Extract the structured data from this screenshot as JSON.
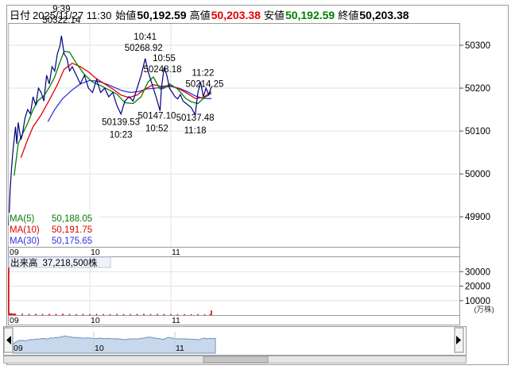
{
  "header": {
    "date_label": "日付",
    "datetime": "2025/11/27 11:30",
    "open_label": "始値",
    "open_value": "50,192.59",
    "high_label": "高値",
    "high_value": "50,203.38",
    "low_label": "安値",
    "low_value": "50,192.59",
    "close_label": "終値",
    "close_value": "50,203.38"
  },
  "legend": {
    "ma5_label": "MA(5)",
    "ma5_value": "50,188.05",
    "ma10_label": "MA(10)",
    "ma10_value": "50,191.75",
    "ma30_label": "MA(30)",
    "ma30_value": "50,175.65"
  },
  "volume_panel": {
    "label": "出来高",
    "value": "37,218,500株",
    "unit": "(万株)"
  },
  "annotations": [
    {
      "time": "9:39",
      "value": "50322.14"
    },
    {
      "time": "10:41",
      "value": "50268.92"
    },
    {
      "time": "10:55",
      "value": "50248.18"
    },
    {
      "time": "11:22",
      "value": "50214.25"
    },
    {
      "time": "10:23",
      "value": "50139.53"
    },
    {
      "time": "10:52",
      "value": "50147.10"
    },
    {
      "time": "11:18",
      "value": "50137.48"
    }
  ],
  "colors": {
    "up": "#e00000",
    "down": "#000080",
    "ma5": "#008000",
    "ma10": "#e00000",
    "ma30": "#3030e0",
    "high_value": "#e00000",
    "low_value": "#008000",
    "navigator_fill": "#c8d8ec",
    "navigator_line": "#6f8fb8"
  },
  "chart_data": {
    "type": "line",
    "title": "",
    "xlabel": "",
    "ylabel": "",
    "price_ylim": [
      49830,
      50350
    ],
    "price_ticks": [
      49900,
      50000,
      50100,
      50200,
      50300
    ],
    "volume_ticks": [
      10000,
      20000,
      30000
    ],
    "volume_unit": "(万株)",
    "x_ticks": [
      "09",
      "10",
      "11"
    ],
    "session": {
      "start": "09:00",
      "end": "11:30"
    },
    "grid": true,
    "legend": "bottom-left",
    "price": {
      "name": "price",
      "points": [
        [
          "09:00",
          49880
        ],
        [
          "09:01",
          49960
        ],
        [
          "09:02",
          50010
        ],
        [
          "09:03",
          50050
        ],
        [
          "09:04",
          50080
        ],
        [
          "09:05",
          50110
        ],
        [
          "09:06",
          50070
        ],
        [
          "09:07",
          50120
        ],
        [
          "09:08",
          50100
        ],
        [
          "09:09",
          50080
        ],
        [
          "09:10",
          50090
        ],
        [
          "09:12",
          50130
        ],
        [
          "09:14",
          50150
        ],
        [
          "09:16",
          50140
        ],
        [
          "09:18",
          50180
        ],
        [
          "09:20",
          50160
        ],
        [
          "09:22",
          50200
        ],
        [
          "09:24",
          50190
        ],
        [
          "09:26",
          50170
        ],
        [
          "09:28",
          50230
        ],
        [
          "09:30",
          50210
        ],
        [
          "09:32",
          50250
        ],
        [
          "09:34",
          50240
        ],
        [
          "09:36",
          50280
        ],
        [
          "09:38",
          50300
        ],
        [
          "09:39",
          50322.14
        ],
        [
          "09:41",
          50280
        ],
        [
          "09:43",
          50270
        ],
        [
          "09:45",
          50240
        ],
        [
          "09:47",
          50250
        ],
        [
          "09:50",
          50230
        ],
        [
          "09:53",
          50210
        ],
        [
          "09:56",
          50230
        ],
        [
          "09:59",
          50200
        ],
        [
          "10:02",
          50190
        ],
        [
          "10:05",
          50220
        ],
        [
          "10:08",
          50190
        ],
        [
          "10:11",
          50200
        ],
        [
          "10:14",
          50180
        ],
        [
          "10:17",
          50190
        ],
        [
          "10:20",
          50160
        ],
        [
          "10:23",
          50139.53
        ],
        [
          "10:26",
          50170
        ],
        [
          "10:29",
          50180
        ],
        [
          "10:32",
          50170
        ],
        [
          "10:35",
          50200
        ],
        [
          "10:38",
          50230
        ],
        [
          "10:41",
          50268.92
        ],
        [
          "10:43",
          50240
        ],
        [
          "10:45",
          50220
        ],
        [
          "10:47",
          50200
        ],
        [
          "10:49",
          50180
        ],
        [
          "10:52",
          50147.1
        ],
        [
          "10:53",
          50200
        ],
        [
          "10:55",
          50248.18
        ],
        [
          "10:57",
          50230
        ],
        [
          "10:59",
          50200
        ],
        [
          "11:01",
          50190
        ],
        [
          "11:03",
          50180
        ],
        [
          "11:05",
          50175
        ],
        [
          "11:07",
          50185
        ],
        [
          "11:09",
          50170
        ],
        [
          "11:11",
          50165
        ],
        [
          "11:13",
          50160
        ],
        [
          "11:15",
          50155
        ],
        [
          "11:18",
          50137.48
        ],
        [
          "11:20",
          50190
        ],
        [
          "11:22",
          50214.25
        ],
        [
          "11:24",
          50180
        ],
        [
          "11:26",
          50200
        ],
        [
          "11:28",
          50185
        ],
        [
          "11:30",
          50203.38
        ]
      ]
    },
    "series": [
      {
        "name": "MA(5)",
        "points": [
          [
            "09:04",
            49996
          ],
          [
            "09:07",
            50070
          ],
          [
            "09:10",
            50092
          ],
          [
            "09:14",
            50118
          ],
          [
            "09:18",
            50150
          ],
          [
            "09:22",
            50172
          ],
          [
            "09:26",
            50182
          ],
          [
            "09:30",
            50202
          ],
          [
            "09:34",
            50226
          ],
          [
            "09:38",
            50262
          ],
          [
            "09:41",
            50286
          ],
          [
            "09:45",
            50284
          ],
          [
            "09:50",
            50258
          ],
          [
            "09:56",
            50232
          ],
          [
            "10:02",
            50214
          ],
          [
            "10:08",
            50206
          ],
          [
            "10:14",
            50196
          ],
          [
            "10:20",
            50186
          ],
          [
            "10:26",
            50166
          ],
          [
            "10:32",
            50164
          ],
          [
            "10:38",
            50180
          ],
          [
            "10:43",
            50214
          ],
          [
            "10:47",
            50226
          ],
          [
            "10:52",
            50198
          ],
          [
            "10:55",
            50200
          ],
          [
            "10:59",
            50210
          ],
          [
            "11:05",
            50198
          ],
          [
            "11:11",
            50176
          ],
          [
            "11:15",
            50168
          ],
          [
            "11:20",
            50164
          ],
          [
            "11:24",
            50176
          ],
          [
            "11:28",
            50184
          ],
          [
            "11:30",
            50188.05
          ]
        ]
      },
      {
        "name": "MA(10)",
        "points": [
          [
            "09:09",
            50038
          ],
          [
            "09:14",
            50080
          ],
          [
            "09:18",
            50110
          ],
          [
            "09:24",
            50138
          ],
          [
            "09:30",
            50172
          ],
          [
            "09:36",
            50208
          ],
          [
            "09:41",
            50244
          ],
          [
            "09:47",
            50258
          ],
          [
            "09:53",
            50250
          ],
          [
            "09:59",
            50238
          ],
          [
            "10:05",
            50222
          ],
          [
            "10:11",
            50210
          ],
          [
            "10:17",
            50198
          ],
          [
            "10:23",
            50184
          ],
          [
            "10:29",
            50178
          ],
          [
            "10:35",
            50184
          ],
          [
            "10:41",
            50198
          ],
          [
            "10:47",
            50208
          ],
          [
            "10:53",
            50204
          ],
          [
            "10:59",
            50206
          ],
          [
            "11:05",
            50200
          ],
          [
            "11:11",
            50190
          ],
          [
            "11:18",
            50176
          ],
          [
            "11:24",
            50178
          ],
          [
            "11:30",
            50191.75
          ]
        ]
      },
      {
        "name": "MA(30)",
        "points": [
          [
            "09:29",
            50122
          ],
          [
            "09:34",
            50150
          ],
          [
            "09:40",
            50176
          ],
          [
            "09:47",
            50196
          ],
          [
            "09:53",
            50210
          ],
          [
            "10:00",
            50218
          ],
          [
            "10:06",
            50216
          ],
          [
            "10:12",
            50210
          ],
          [
            "10:18",
            50202
          ],
          [
            "10:24",
            50194
          ],
          [
            "10:30",
            50190
          ],
          [
            "10:36",
            50192
          ],
          [
            "10:42",
            50198
          ],
          [
            "10:48",
            50200
          ],
          [
            "10:54",
            50202
          ],
          [
            "11:00",
            50204
          ],
          [
            "11:06",
            50200
          ],
          [
            "11:12",
            50192
          ],
          [
            "11:18",
            50182
          ],
          [
            "11:24",
            50176
          ],
          [
            "11:30",
            50175.65
          ]
        ]
      }
    ],
    "volume": [
      [
        "09:00",
        33000
      ],
      [
        "09:01",
        1300
      ],
      [
        "09:02",
        1200
      ],
      [
        "09:03",
        1000
      ],
      [
        "09:04",
        1100
      ],
      [
        "09:05",
        900
      ],
      [
        "09:10",
        1000
      ],
      [
        "09:15",
        800
      ],
      [
        "09:20",
        900
      ],
      [
        "09:25",
        800
      ],
      [
        "09:30",
        900
      ],
      [
        "09:35",
        800
      ],
      [
        "09:40",
        1000
      ],
      [
        "09:45",
        800
      ],
      [
        "09:50",
        700
      ],
      [
        "09:55",
        800
      ],
      [
        "10:00",
        700
      ],
      [
        "10:05",
        800
      ],
      [
        "10:10",
        700
      ],
      [
        "10:15",
        700
      ],
      [
        "10:20",
        800
      ],
      [
        "10:25",
        700
      ],
      [
        "10:30",
        700
      ],
      [
        "10:35",
        800
      ],
      [
        "10:40",
        900
      ],
      [
        "10:45",
        700
      ],
      [
        "10:50",
        800
      ],
      [
        "10:55",
        800
      ],
      [
        "11:00",
        700
      ],
      [
        "11:05",
        600
      ],
      [
        "11:10",
        700
      ],
      [
        "11:15",
        600
      ],
      [
        "11:20",
        700
      ],
      [
        "11:25",
        600
      ],
      [
        "11:29",
        600
      ],
      [
        "11:30",
        3200
      ]
    ]
  }
}
